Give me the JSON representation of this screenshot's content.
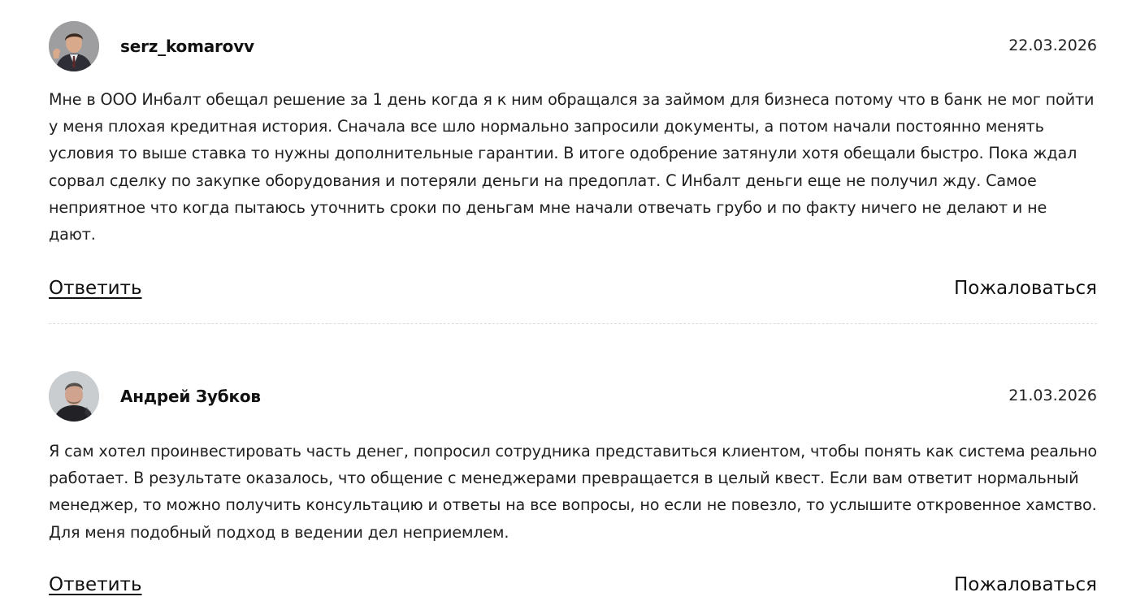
{
  "reviews": [
    {
      "author": "serz_komarovv",
      "date": "22.03.2026",
      "text": "Мне в ООО Инбалт обещал решение за 1 день когда я к ним обращался за займом для бизнеса потому что в банк не мог пойти у меня плохая кредитная история. Сначала все шло нормально запросили документы, а потом начали постоянно менять условия то выше ставка то нужны дополнительные гарантии. В итоге одобрение затянули хотя обещали быстро. Пока ждал сорвал сделку по закупке оборудования и потеряли деньги на предоплат. С Инбалт деньги еще не получил жду. Самое неприятное что когда пытаюсь уточнить сроки по деньгам мне начали отвечать грубо и по факту ничего не делают и не дают.",
      "reply_label": "Ответить",
      "complain_label": "Пожаловаться"
    },
    {
      "author": "Андрей Зубков",
      "date": "21.03.2026",
      "text": "Я сам хотел проинвестировать часть денег, попросил сотрудника представиться клиентом, чтобы понять как система реально работает. В результате оказалось, что общение с менеджерами превращается в целый квест. Если вам ответит нормальный менеджер, то можно получить консультацию и ответы на все вопросы, но если не повезло, то услышите откровенное хамство. Для меня подобный подход в ведении дел неприемлем.",
      "reply_label": "Ответить",
      "complain_label": "Пожаловаться"
    }
  ]
}
